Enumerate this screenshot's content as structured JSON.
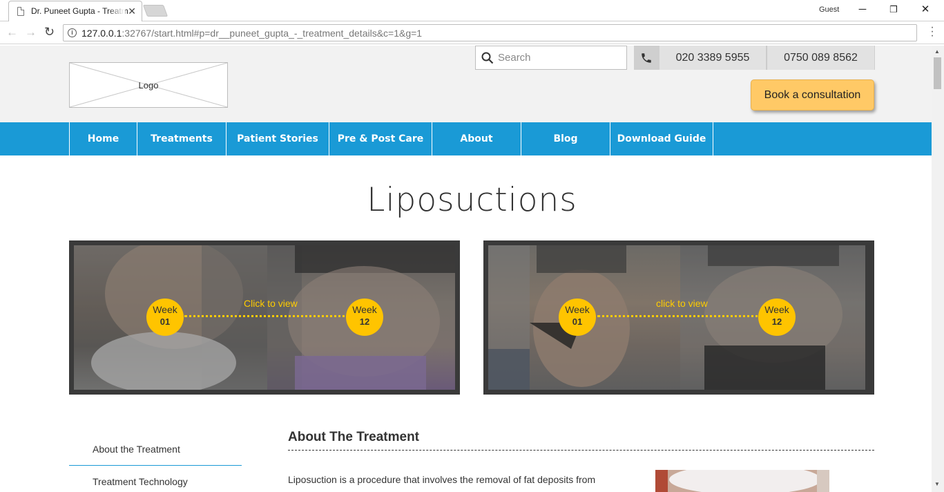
{
  "browser": {
    "tab_title": "Dr. Puneet Gupta - Treatm",
    "profile": "Guest",
    "url_host": "127.0.0.1",
    "url_rest": ":32767/start.html#p=dr__puneet_gupta_-_treatment_details&c=1&g=1"
  },
  "header": {
    "logo_text": "Logo",
    "search_placeholder": "Search",
    "phone1": "020 3389 5955",
    "phone2": "0750 089 8562",
    "book_label": "Book a consultation"
  },
  "nav": {
    "items": [
      {
        "label": "Home"
      },
      {
        "label": "Treatments"
      },
      {
        "label": "Patient Stories"
      },
      {
        "label": "Pre & Post Care"
      },
      {
        "label": "About"
      },
      {
        "label": "Blog"
      },
      {
        "label": "Download Guide"
      }
    ]
  },
  "page": {
    "title": "Liposuctions"
  },
  "before_after": [
    {
      "caption": "Click to view",
      "before_week_label": "Week",
      "before_week_num": "01",
      "after_week_label": "Week",
      "after_week_num": "12"
    },
    {
      "caption": "click to view",
      "before_week_label": "Week",
      "before_week_num": "01",
      "after_week_label": "Week",
      "after_week_num": "12"
    }
  ],
  "sidebar": {
    "items": [
      {
        "label": "About the Treatment"
      },
      {
        "label": "Treatment Technology"
      }
    ]
  },
  "content": {
    "section_title": "About The Treatment",
    "intro_text": "Liposuction is a procedure that involves the removal of fat deposits from"
  },
  "colors": {
    "nav_blue": "#1a9ad6",
    "accent_yellow": "#ffc400",
    "book_button": "#ffc966"
  }
}
